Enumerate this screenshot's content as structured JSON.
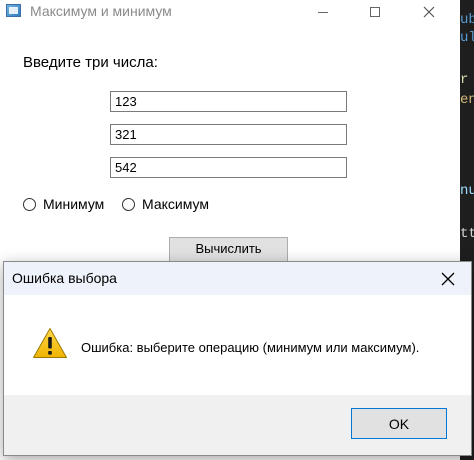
{
  "background_editor": {
    "fragments": [
      "ub",
      "ul",
      "r",
      "en",
      "nu",
      "tt"
    ]
  },
  "main_window": {
    "title": "Максимум и минимум",
    "prompt": "Введите три числа:",
    "inputs": [
      "123",
      "321",
      "542"
    ],
    "radio_min_label": "Минимум",
    "radio_max_label": "Максимум",
    "compute_button": "Вычислить"
  },
  "dialog": {
    "title": "Ошибка выбора",
    "message": "Ошибка: выберите операцию (минимум или максимум).",
    "ok_button": "OK",
    "icon": "warning-icon"
  },
  "colors": {
    "dialog_titlebar": "#eef2fa",
    "dialog_footer": "#f0f0f0",
    "ok_border_accent": "#0078d7",
    "warning_yellow": "#f5c400"
  }
}
